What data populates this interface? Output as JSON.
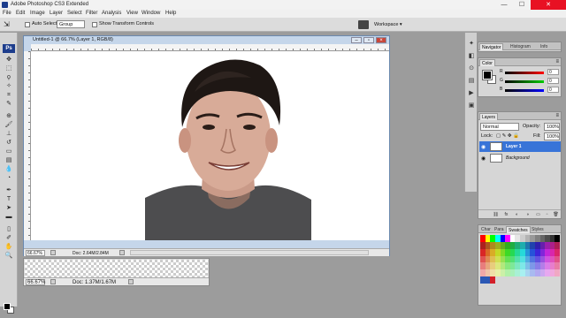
{
  "app": {
    "title": "Adobe Photoshop CS3 Extended",
    "window_controls": [
      "—",
      "☐",
      "✕"
    ]
  },
  "menu": [
    "File",
    "Edit",
    "Image",
    "Layer",
    "Select",
    "Filter",
    "Analysis",
    "View",
    "Window",
    "Help"
  ],
  "options_bar": {
    "auto_select_label": "Auto Select:",
    "auto_select_value": "Group",
    "transform_label": "Show Transform Controls",
    "workspace_label": "Workspace ▾"
  },
  "document": {
    "title": "Untitled-1 @ 66.7% (Layer 1, RGB/8)",
    "zoom": "66.67%",
    "doc_info": "Doc: 2.64M/2.84M"
  },
  "document2": {
    "zoom": "66.67%",
    "doc_info": "Doc: 1.37M/1.67M"
  },
  "panels": {
    "navigator_tabs": [
      "Navigator",
      "Histogram",
      "Info"
    ],
    "color_tabs": [
      "Color",
      "Swatches"
    ],
    "color_sliders": [
      {
        "letter": "R",
        "value": "0"
      },
      {
        "letter": "G",
        "value": "0"
      },
      {
        "letter": "B",
        "value": "0"
      }
    ],
    "layers_tabs": [
      "Layers"
    ],
    "blend_mode": "Normal",
    "opacity_label": "Opacity:",
    "opacity_value": "100%",
    "lock_label": "Lock:",
    "fill_label": "Fill:",
    "fill_value": "100%",
    "layers": [
      {
        "name": "Layer 1",
        "selected": true
      },
      {
        "name": "Background",
        "selected": false
      }
    ],
    "swatch_tabs": [
      "Char",
      "Para",
      "Swatches",
      "Styles"
    ]
  },
  "colors": {
    "selection": "#3874d8",
    "title_close": "#e81123"
  }
}
